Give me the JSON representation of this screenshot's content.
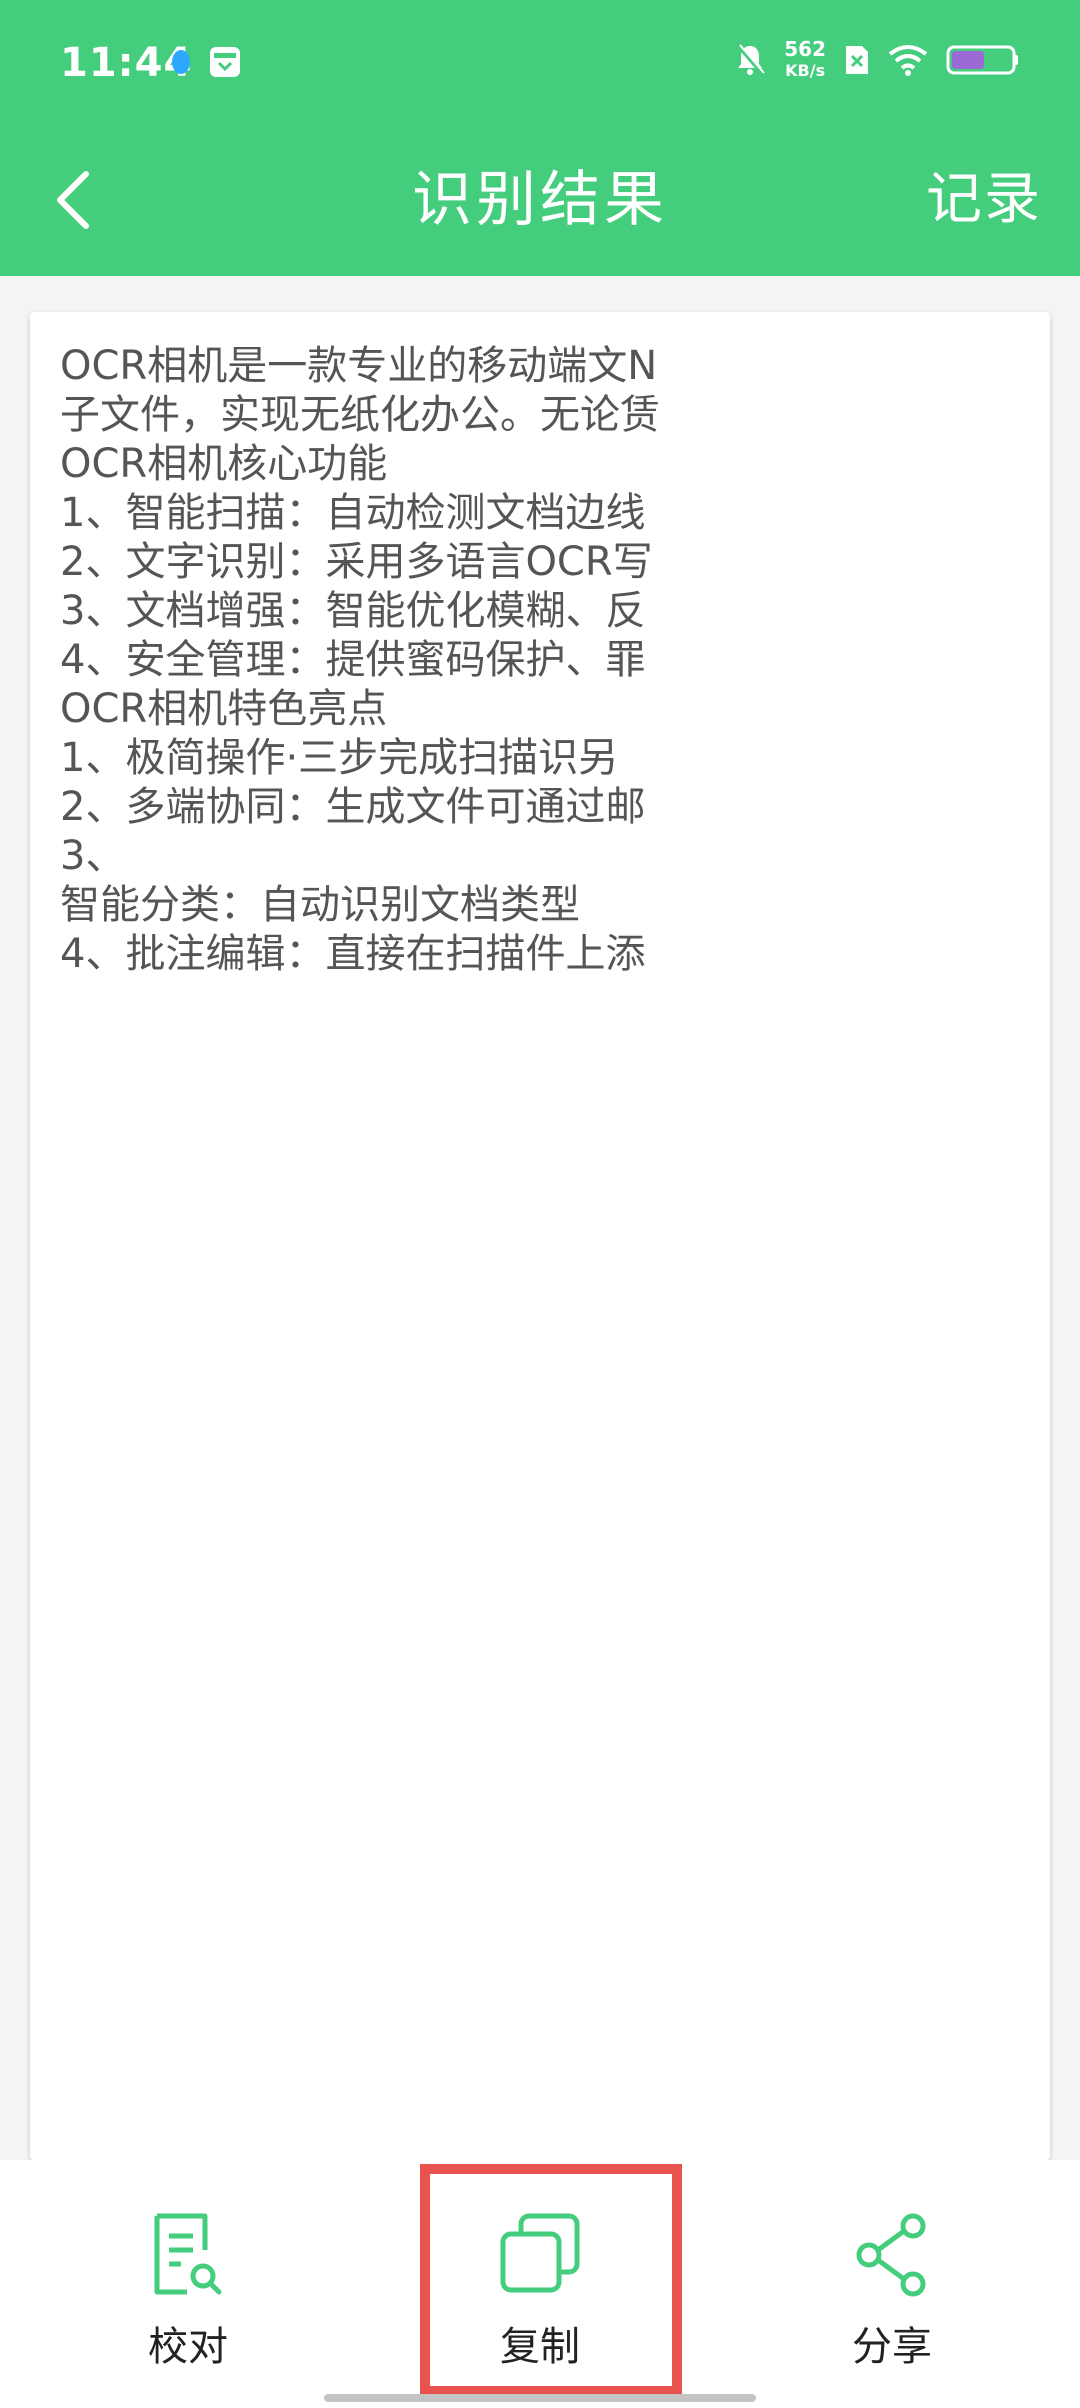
{
  "status_bar": {
    "time": "11:44",
    "net_speed_value": "562",
    "net_speed_unit": "KB/s"
  },
  "header": {
    "title": "识别结果",
    "record_label": "记录"
  },
  "result": {
    "lines": [
      "OCR相机是一款专业的移动端文N",
      "子文件，实现无纸化办公。无论赁",
      "OCR相机核心功能",
      "1、智能扫描：自动检测文档边线",
      "2、文字识别：采用多语言OCR写",
      "3、文档增强：智能优化模糊、反",
      "4、安全管理：提供蜜码保护、罪",
      "OCR相机特色亮点",
      "1、极简操作·三步完成扫描识另",
      "2、多端协同：生成文件可通过邮",
      "3、",
      "智能分类：自动识别文档类型",
      "4、批注编辑：直接在扫描件上添"
    ]
  },
  "bottom_bar": {
    "proofread_label": "校对",
    "copy_label": "复制",
    "share_label": "分享"
  },
  "colors": {
    "brand_green": "#45cd7e",
    "highlight_red": "#e8524f",
    "text_gray": "#555555"
  },
  "icons": {
    "back": "chevron-left-icon",
    "proofread": "document-search-icon",
    "copy": "copy-icon",
    "share": "share-icon"
  }
}
